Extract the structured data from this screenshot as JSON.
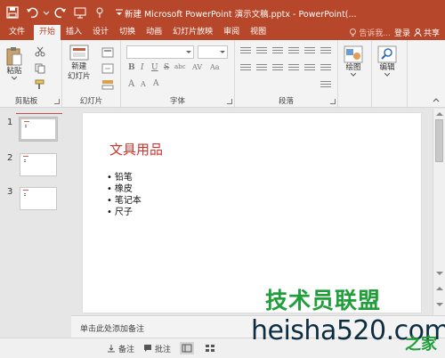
{
  "window": {
    "title": "新建 Microsoft PowerPoint 演示文稿.pptx - PowerPoint(..."
  },
  "tabs": [
    "文件",
    "开始",
    "插入",
    "设计",
    "切换",
    "动画",
    "幻灯片放映",
    "审阅",
    "视图"
  ],
  "tab_right": {
    "tell_me": "告诉我...",
    "login": "登录",
    "share": "共享"
  },
  "ribbon": {
    "clipboard": {
      "paste_label": "粘贴",
      "group_label": "剪贴板"
    },
    "slides": {
      "new_slide_label_1": "新建",
      "new_slide_label_2": "幻灯片",
      "group_label": "幻灯片"
    },
    "font": {
      "group_label": "字体",
      "bold": "B",
      "italic": "I",
      "underline": "U",
      "strike": "S",
      "shadow": "abc",
      "spacing": "AV",
      "case": "Aa",
      "grow": "A",
      "shrink": "A",
      "clear": "A"
    },
    "paragraph": {
      "group_label": "段落"
    },
    "drawing": {
      "label": "绘图"
    },
    "editing": {
      "label": "编辑"
    }
  },
  "thumbnails": [
    {
      "number": "1"
    },
    {
      "number": "2"
    },
    {
      "number": "3"
    }
  ],
  "slide": {
    "title": "文具用品",
    "bullets": [
      "铅笔",
      "橡皮",
      "笔记本",
      "尺子"
    ]
  },
  "notes": {
    "placeholder": "单击此处添加备注"
  },
  "status": {
    "notes_label": "备注",
    "comments_label": "批注"
  },
  "watermark": {
    "top": "技术员联盟",
    "bottom": "heisha520.com",
    "tail": "之家"
  },
  "colors": {
    "accent": "#b7472a",
    "title_red": "#d0342c"
  }
}
